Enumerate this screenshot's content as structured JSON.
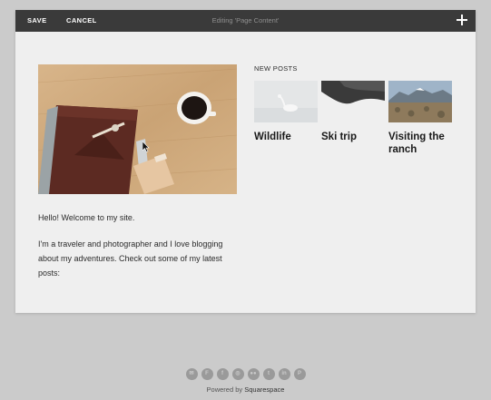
{
  "toolbar": {
    "save_label": "SAVE",
    "cancel_label": "CANCEL",
    "title": "Editing 'Page Content'",
    "add_icon": "plus-icon"
  },
  "content": {
    "intro_1": "Hello! Welcome to my site.",
    "intro_2": "I'm a traveler and photographer and I love blogging about my adventures. Check out some of my latest posts:"
  },
  "new_posts": {
    "heading": "NEW POSTS",
    "items": [
      {
        "title": "Wildlife"
      },
      {
        "title": "Ski trip"
      },
      {
        "title": "Visiting the ranch"
      }
    ]
  },
  "footer": {
    "social_icons": [
      "email-icon",
      "foursquare-icon",
      "facebook-icon",
      "instagram-icon",
      "flickr-icon",
      "twitter-icon",
      "linkedin-icon",
      "pinterest-icon"
    ],
    "social_glyphs": [
      "✉",
      "F",
      "f",
      "◎",
      "●●",
      "t",
      "in",
      "P"
    ],
    "powered_prefix": "Powered by ",
    "powered_link": "Squarespace"
  },
  "colors": {
    "toolbar_bg": "#3a3a3a",
    "page_bg": "#cbcbcb",
    "editor_bg": "#efefef"
  }
}
